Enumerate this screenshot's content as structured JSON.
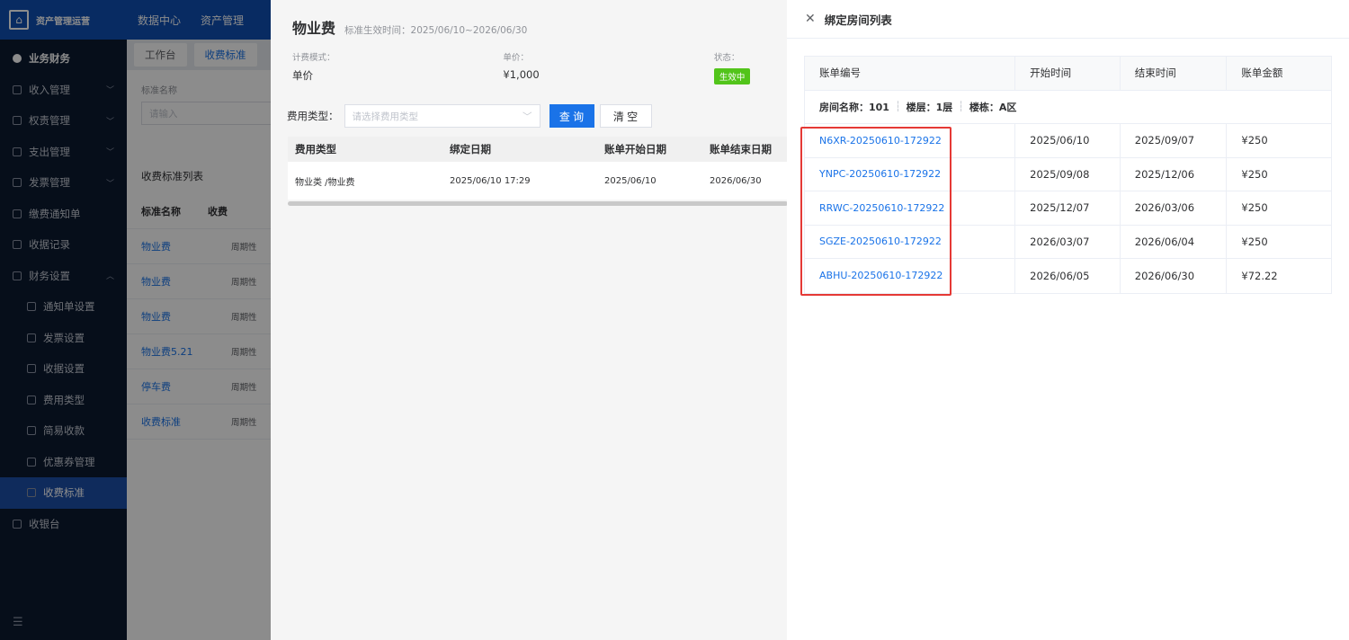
{
  "sidebar": {
    "brand": "资产管理运营",
    "items": [
      {
        "label": "业务财务",
        "top": true
      },
      {
        "label": "收入管理",
        "arrow": "﹀"
      },
      {
        "label": "权责管理",
        "arrow": "﹀"
      },
      {
        "label": "支出管理",
        "arrow": "﹀"
      },
      {
        "label": "发票管理",
        "arrow": "﹀"
      },
      {
        "label": "缴费通知单"
      },
      {
        "label": "收据记录"
      },
      {
        "label": "财务设置",
        "arrow": "︿"
      },
      {
        "label": "通知单设置",
        "sub": true
      },
      {
        "label": "发票设置",
        "sub": true
      },
      {
        "label": "收据设置",
        "sub": true
      },
      {
        "label": "费用类型",
        "sub": true
      },
      {
        "label": "简易收款",
        "sub": true
      },
      {
        "label": "优惠券管理",
        "sub": true
      },
      {
        "label": "收费标准",
        "sub": true,
        "active": true
      },
      {
        "label": "收银台"
      }
    ]
  },
  "topbar": {
    "items": [
      "数据中心",
      "资产管理"
    ]
  },
  "tabs": {
    "items": [
      "工作台",
      "收费标准"
    ]
  },
  "bg_page": {
    "filter_label": "标准名称",
    "filter_placeholder": "请输入",
    "list_title": "收费标准列表",
    "table_head": [
      "标准名称",
      "收费"
    ],
    "rows": [
      {
        "name": "物业费",
        "type": "周期性"
      },
      {
        "name": "物业费",
        "type": "周期性"
      },
      {
        "name": "物业费",
        "type": "周期性"
      },
      {
        "name": "物业费5.21",
        "type": "周期性"
      },
      {
        "name": "停车费",
        "type": "周期性"
      },
      {
        "name": "收费标准",
        "type": "周期性"
      }
    ]
  },
  "mid_drawer": {
    "title": "物业费",
    "subtitle": "标准生效时间：2025/06/10~2026/06/30",
    "info": [
      {
        "label": "计费模式：",
        "value": "单价"
      },
      {
        "label": "单价：",
        "value": "¥1,000"
      },
      {
        "label": "状态：",
        "value": "生效中"
      }
    ],
    "search_label": "费用类型：",
    "select_placeholder": "请选择费用类型",
    "query_button": "查 询",
    "clear_button": "清 空",
    "table_head": [
      "费用类型",
      "绑定日期",
      "账单开始日期",
      "账单结束日期"
    ],
    "table_row": [
      "物业类 /物业费",
      "2025/06/10 17:29",
      "2025/06/10",
      "2026/06/30"
    ]
  },
  "drawer": {
    "title": "绑定房间列表",
    "columns": [
      "账单编号",
      "开始时间",
      "结束时间",
      "账单金额"
    ],
    "group": {
      "room": "房间名称：101",
      "floor": "楼层：1层",
      "building": "楼栋：A区"
    },
    "rows": [
      {
        "bill": "N6XR-20250610-172922",
        "start": "2025/06/10",
        "end": "2025/09/07",
        "amount": "¥250"
      },
      {
        "bill": "YNPC-20250610-172922",
        "start": "2025/09/08",
        "end": "2025/12/06",
        "amount": "¥250"
      },
      {
        "bill": "RRWC-20250610-172922",
        "start": "2025/12/07",
        "end": "2026/03/06",
        "amount": "¥250"
      },
      {
        "bill": "SGZE-20250610-172922",
        "start": "2026/03/07",
        "end": "2026/06/04",
        "amount": "¥250"
      },
      {
        "bill": "ABHU-20250610-172922",
        "start": "2026/06/05",
        "end": "2026/06/30",
        "amount": "¥72.22"
      }
    ]
  },
  "colors": {
    "primary": "#1a73e8",
    "sidebar": "#0b1a31",
    "highlight": "#e53935",
    "badge": "#52c41a"
  }
}
